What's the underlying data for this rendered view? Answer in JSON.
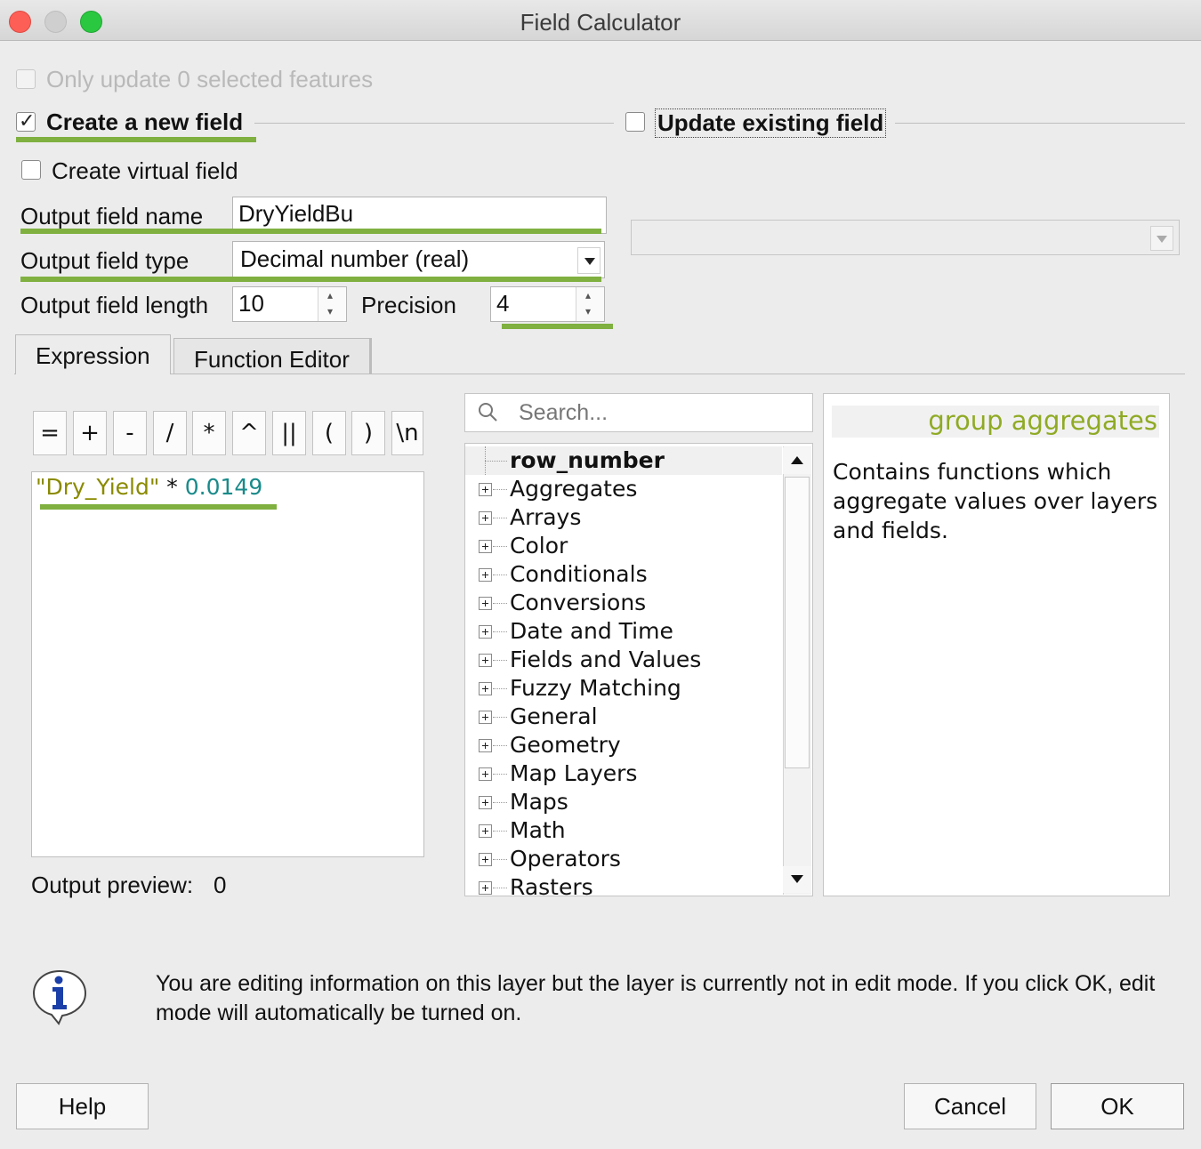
{
  "window": {
    "title": "Field Calculator"
  },
  "options": {
    "only_update_label": "Only update 0 selected features",
    "create_new_field_label": "Create a new field",
    "create_new_field_checked": true,
    "update_existing_label": "Update existing field",
    "update_existing_checked": false,
    "create_virtual_label": "Create virtual field",
    "create_virtual_checked": false
  },
  "fields": {
    "output_name_label": "Output field name",
    "output_name_value": "DryYieldBu",
    "output_type_label": "Output field type",
    "output_type_value": "Decimal number (real)",
    "output_length_label": "Output field length",
    "output_length_value": "10",
    "precision_label": "Precision",
    "precision_value": "4"
  },
  "tabs": [
    {
      "label": "Expression",
      "active": true
    },
    {
      "label": "Function Editor",
      "active": false
    }
  ],
  "operators": [
    "=",
    "+",
    "-",
    "/",
    "*",
    "^",
    "||",
    "(",
    ")",
    "\\n"
  ],
  "expression": {
    "field_token": "\"Dry_Yield\"",
    "operator_token": " * ",
    "number_token": "0.0149",
    "colors": {
      "field": "#8a8a00",
      "number": "#1a8a8a",
      "operator": "#111111"
    }
  },
  "preview": {
    "label": "Output preview:",
    "value": "0"
  },
  "search": {
    "placeholder": "Search..."
  },
  "function_tree": [
    "row_number",
    "Aggregates",
    "Arrays",
    "Color",
    "Conditionals",
    "Conversions",
    "Date and Time",
    "Fields and Values",
    "Fuzzy Matching",
    "General",
    "Geometry",
    "Map Layers",
    "Maps",
    "Math",
    "Operators",
    "Rasters"
  ],
  "help": {
    "title": "group aggregates",
    "body": "Contains functions which aggregate values over layers and fields."
  },
  "info_message": "You are editing information on this layer but the layer is currently not in edit mode. If you click OK, edit mode will automatically be turned on.",
  "buttons": {
    "help": "Help",
    "cancel": "Cancel",
    "ok": "OK"
  },
  "colors": {
    "highlight": "#7fb040",
    "help_title": "#8faa24"
  }
}
